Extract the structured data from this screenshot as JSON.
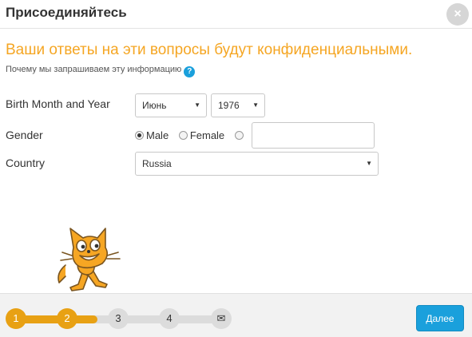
{
  "header": {
    "title": "Присоединяйтесь",
    "close_symbol": "×"
  },
  "intro": {
    "headline": "Ваши ответы на эти вопросы будут конфиденциальными.",
    "why_link": "Почему мы запрашиваем эту информацию",
    "help_symbol": "?"
  },
  "form": {
    "birth_label": "Birth Month and Year",
    "birth_month": "Июнь",
    "birth_year": "1976",
    "gender_label": "Gender",
    "gender_options": [
      "Male",
      "Female"
    ],
    "gender_selected": "Male",
    "gender_other_value": "",
    "country_label": "Country",
    "country_value": "Russia"
  },
  "footer": {
    "steps": [
      "1",
      "2",
      "3",
      "4"
    ],
    "current_step": 2,
    "mail_symbol": "✉",
    "next_label": "Далее"
  },
  "colors": {
    "accent_orange": "#f5a623",
    "progress_orange": "#e8a114",
    "button_blue": "#1aa0dc"
  },
  "icons": {
    "close": "close-icon",
    "help": "question-icon",
    "mail": "envelope-icon",
    "mascot": "scratch-cat"
  }
}
